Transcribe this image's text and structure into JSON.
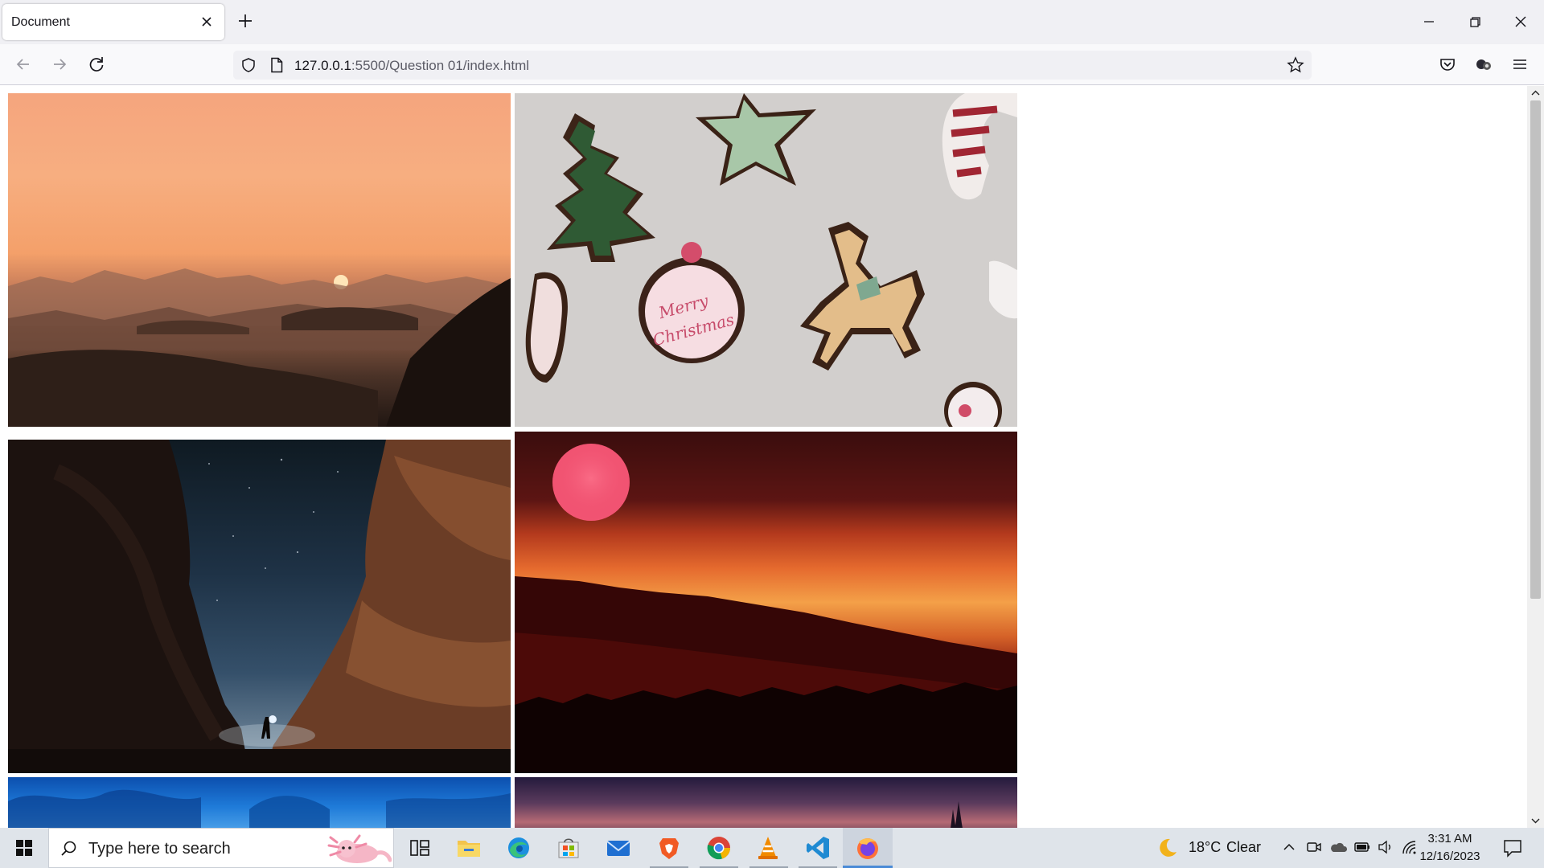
{
  "browser": {
    "tab": {
      "title": "Document",
      "close_icon": "close-icon"
    },
    "new_tab_icon": "plus-icon",
    "window_controls": [
      "minimize-icon",
      "restore-icon",
      "close-icon"
    ],
    "nav": {
      "back_icon": "arrow-left-icon",
      "forward_icon": "arrow-right-icon",
      "reload_icon": "reload-icon"
    },
    "url": {
      "host": "127.0.0.1",
      "path": ":5500/Question 01/index.html"
    },
    "toolbar_icons": [
      "shield-icon",
      "page-icon",
      "star-icon",
      "pocket-icon",
      "extensions-icon",
      "menu-icon"
    ]
  },
  "gallery": {
    "images": [
      {
        "name": "desert-sunset",
        "subject": "desert sunset over rocky valley"
      },
      {
        "name": "christmas-cookies",
        "subject": "decorated christmas cookies",
        "text": "Merry Christmas"
      },
      {
        "name": "canyon-night",
        "subject": "canyon under starry night sky"
      },
      {
        "name": "red-sun-hills",
        "subject": "red sun over forested hills"
      },
      {
        "name": "underwater-blue",
        "subject": "underwater blue scene"
      },
      {
        "name": "purple-dusk",
        "subject": "purple dusk sky"
      }
    ]
  },
  "taskbar": {
    "search_placeholder": "Type here to search",
    "apps": [
      "task-view-icon",
      "file-explorer-icon",
      "edge-icon",
      "store-icon",
      "mail-icon",
      "brave-icon",
      "chrome-icon",
      "vlc-icon",
      "vscode-icon",
      "firefox-icon"
    ],
    "weather": {
      "temp": "18°C",
      "condition": "Clear"
    },
    "clock": {
      "time": "3:31 AM",
      "date": "12/16/2023"
    }
  },
  "colors": {
    "accent": "#4a8ad6",
    "tab_strip": "#f0f0f4",
    "taskbar": "#dfe4ea"
  }
}
